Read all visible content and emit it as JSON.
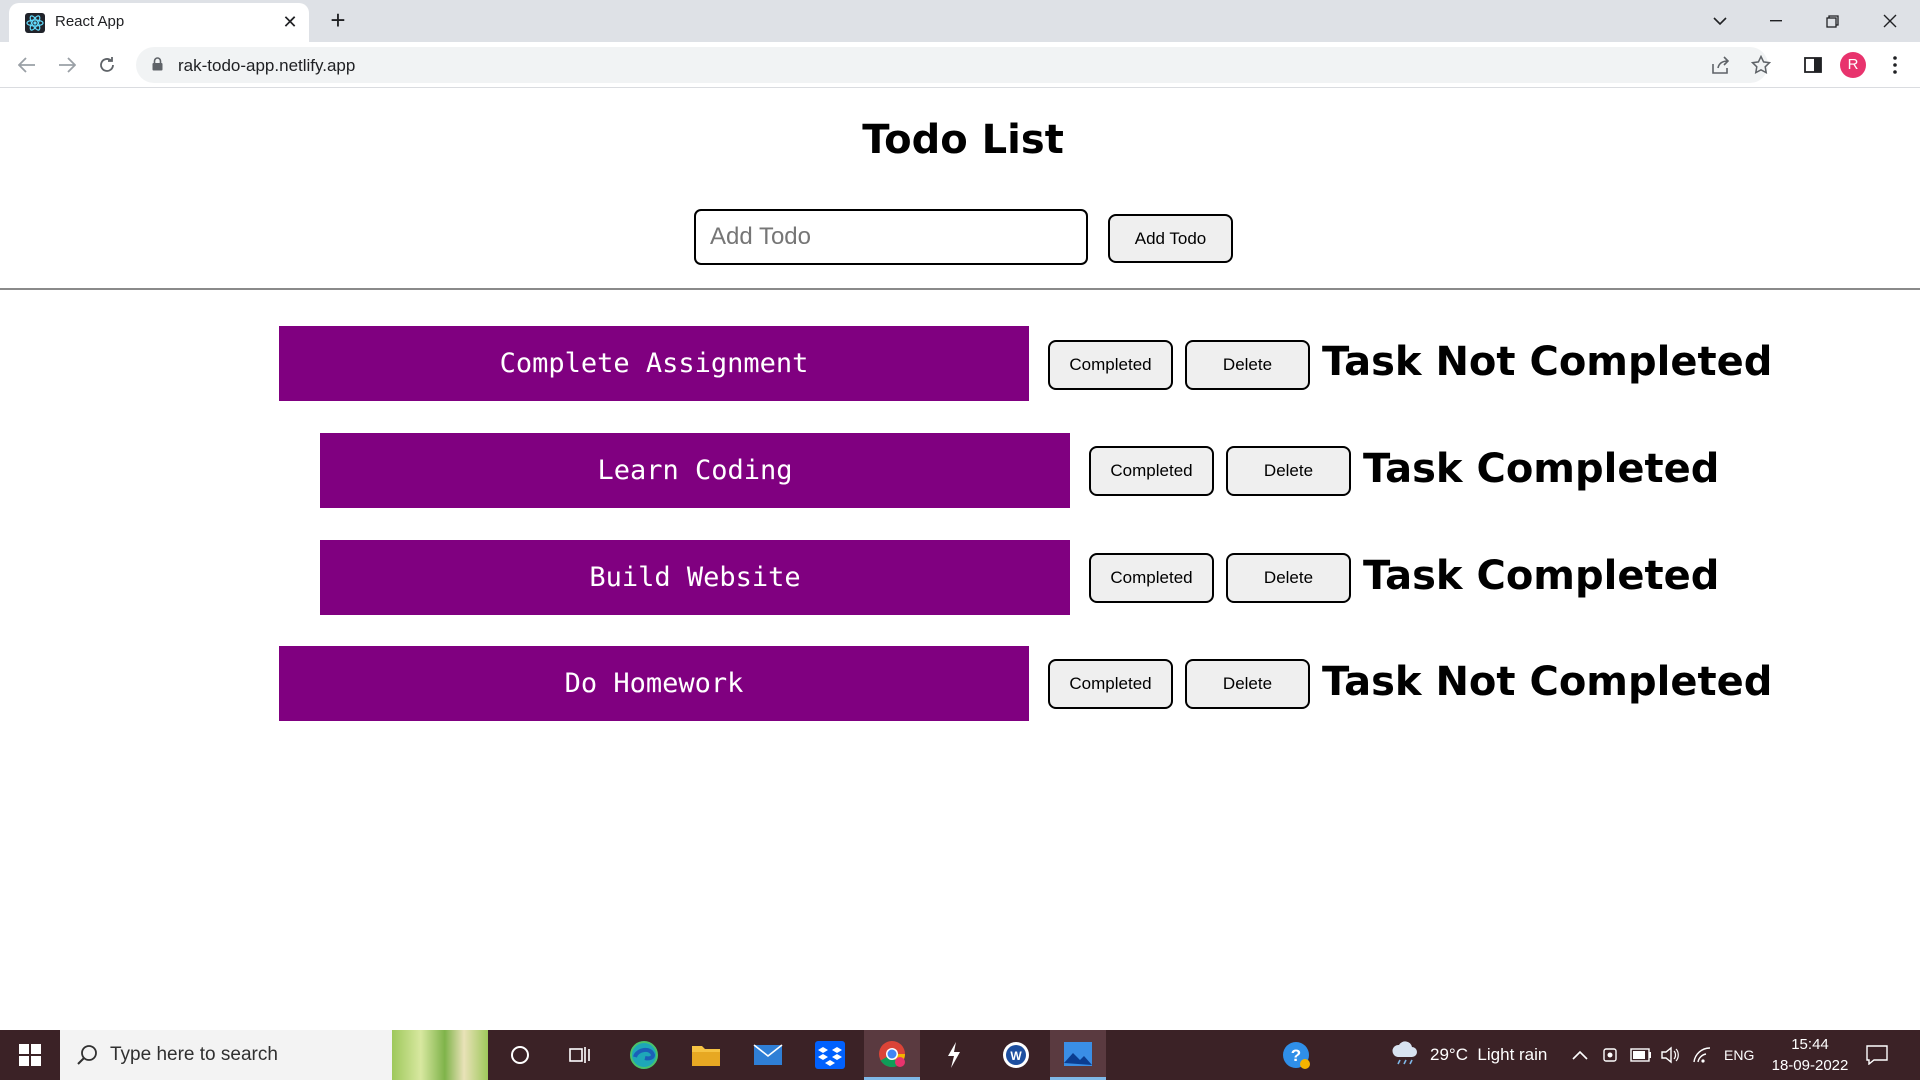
{
  "browser": {
    "tab_title": "React App",
    "url": "rak-todo-app.netlify.app",
    "profile_initial": "R"
  },
  "app": {
    "title": "Todo List",
    "input_placeholder": "Add Todo",
    "add_button_label": "Add Todo",
    "todos": [
      {
        "text": "Complete Assignment",
        "completed_label": "Completed",
        "delete_label": "Delete",
        "status": "Task Not Completed"
      },
      {
        "text": "Learn Coding",
        "completed_label": "Completed",
        "delete_label": "Delete",
        "status": "Task Completed"
      },
      {
        "text": "Build Website",
        "completed_label": "Completed",
        "delete_label": "Delete",
        "status": "Task Completed"
      },
      {
        "text": "Do Homework",
        "completed_label": "Completed",
        "delete_label": "Delete",
        "status": "Task Not Completed"
      }
    ],
    "colors": {
      "todo_background": "#800080",
      "todo_text": "#ffffff"
    }
  },
  "taskbar": {
    "search_placeholder": "Type here to search",
    "weather": "29°C  Light rain",
    "language": "ENG",
    "time": "15:44",
    "date": "18-09-2022"
  }
}
